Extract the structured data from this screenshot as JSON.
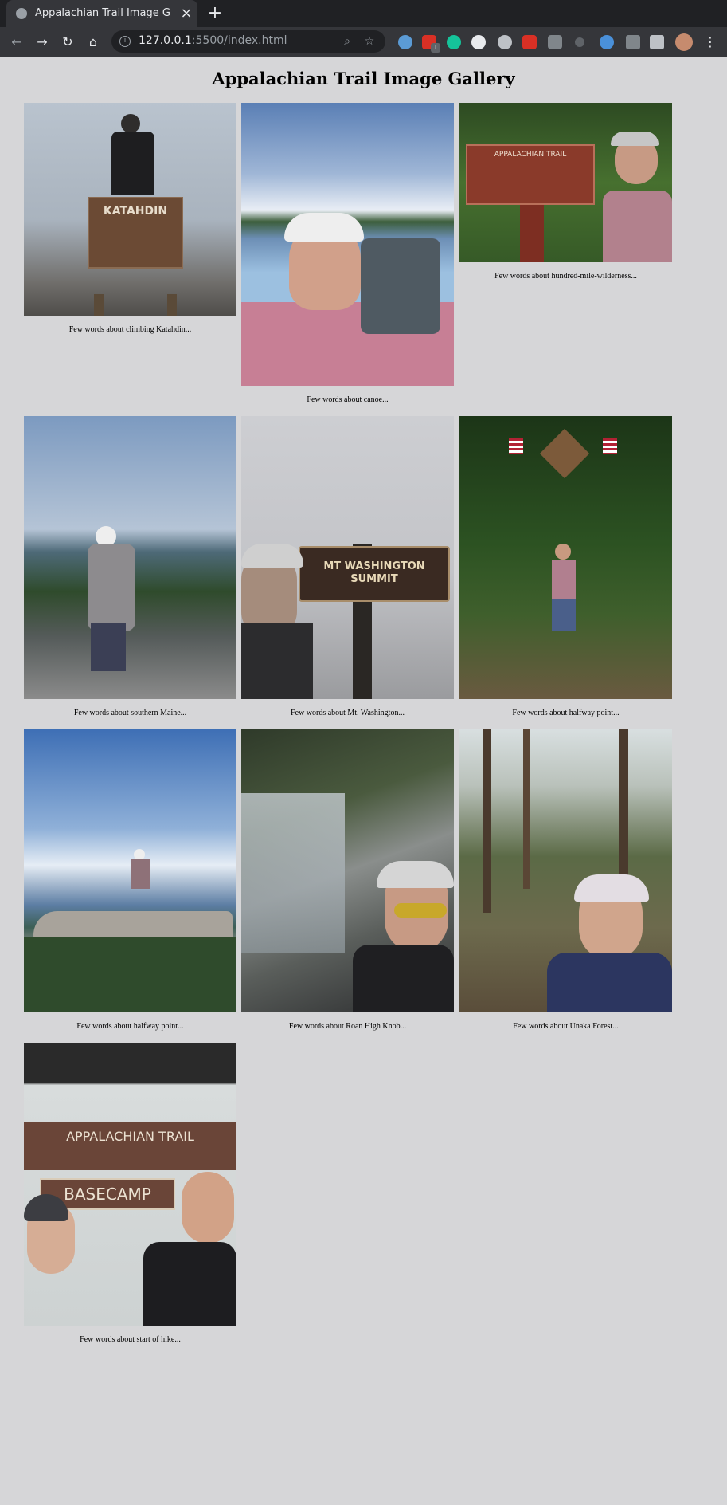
{
  "browser": {
    "tab_title": "Appalachian Trail Image G",
    "url_host": "127.0.0.1",
    "url_rest": ":5500/index.html",
    "extension_badge": "1"
  },
  "gallery": {
    "title": "Appalachian Trail Image Gallery",
    "items": [
      {
        "caption": "Few words about climbing Katahdin...",
        "sign_text": "KATAHDIN"
      },
      {
        "caption": "Few words about canoe..."
      },
      {
        "caption": "Few words about hundred-mile-wilderness...",
        "sign_text": "APPALACHIAN TRAIL"
      },
      {
        "caption": "Few words about southern Maine..."
      },
      {
        "caption": "Few words about Mt. Washington...",
        "sign_text": "MT WASHINGTON SUMMIT"
      },
      {
        "caption": "Few words about halfway point..."
      },
      {
        "caption": "Few words about halfway point..."
      },
      {
        "caption": "Few words about Roan High Knob..."
      },
      {
        "caption": "Few words about Unaka Forest..."
      },
      {
        "caption": "Few words about start of hike...",
        "sign_text": "BASECAMP"
      }
    ]
  }
}
